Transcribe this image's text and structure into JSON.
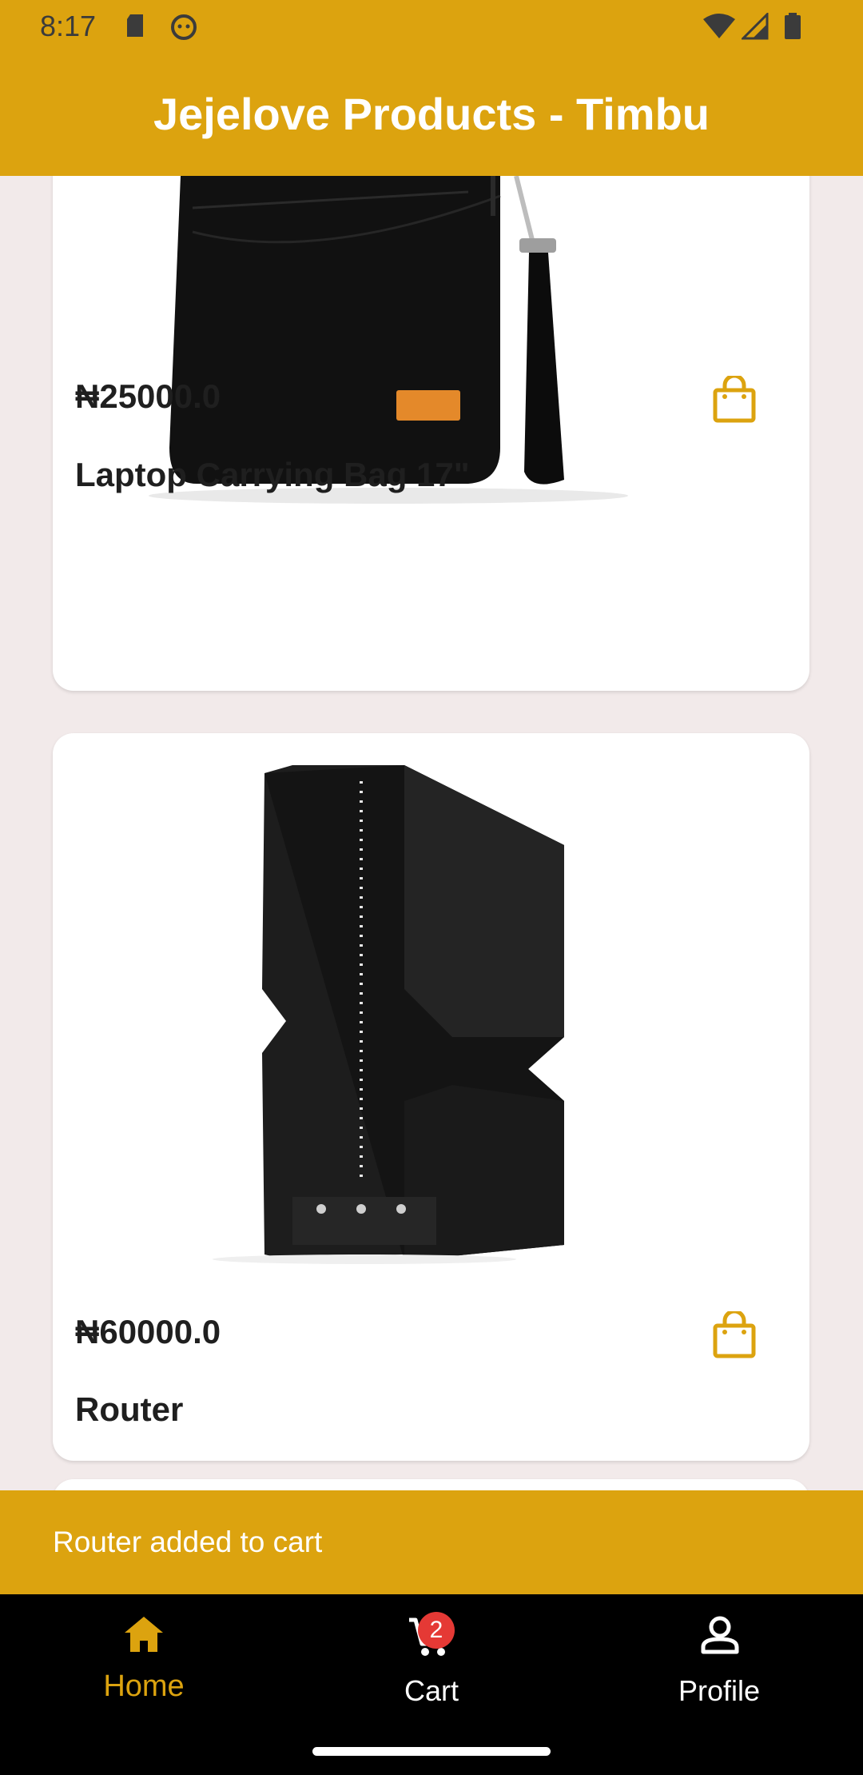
{
  "status_bar": {
    "time": "8:17"
  },
  "app_bar": {
    "title": "Jejelove Products - Timbu"
  },
  "products": [
    {
      "price": "₦25000.0",
      "name": "Laptop Carrying Bag 17\""
    },
    {
      "price": "₦60000.0",
      "name": "Router"
    }
  ],
  "snackbar": {
    "message": "Router added to cart"
  },
  "bottom_nav": {
    "items": [
      {
        "label": "Home",
        "icon": "home-icon",
        "selected": true
      },
      {
        "label": "Cart",
        "icon": "cart-icon",
        "badge": "2"
      },
      {
        "label": "Profile",
        "icon": "profile-icon"
      }
    ]
  },
  "colors": {
    "accent": "#dca30f",
    "selected": "#dca30f",
    "badge": "#e53935"
  }
}
